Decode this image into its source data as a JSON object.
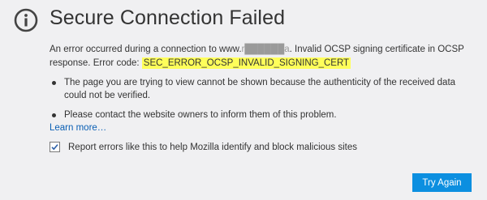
{
  "page": {
    "title": "Secure Connection Failed",
    "icon": "info-circle-icon"
  },
  "description": {
    "prefix": "An error occurred during a connection to www.",
    "redacted_host": "r██████a",
    "suffix": ". Invalid OCSP signing certificate in OCSP response. Error code: ",
    "error_code": "SEC_ERROR_OCSP_INVALID_SIGNING_CERT"
  },
  "bullets": [
    "The page you are trying to view cannot be shown because the authenticity of the received data could not be verified.",
    "Please contact the website owners to inform them of this problem."
  ],
  "learn_more": "Learn more…",
  "report": {
    "label": "Report errors like this to help Mozilla identify and block malicious sites",
    "checked": true
  },
  "try_again_label": "Try Again",
  "colors": {
    "background": "#f0f0f2",
    "link": "#0a5fb4",
    "button": "#0c8fe0",
    "highlight": "#ffff5a"
  }
}
